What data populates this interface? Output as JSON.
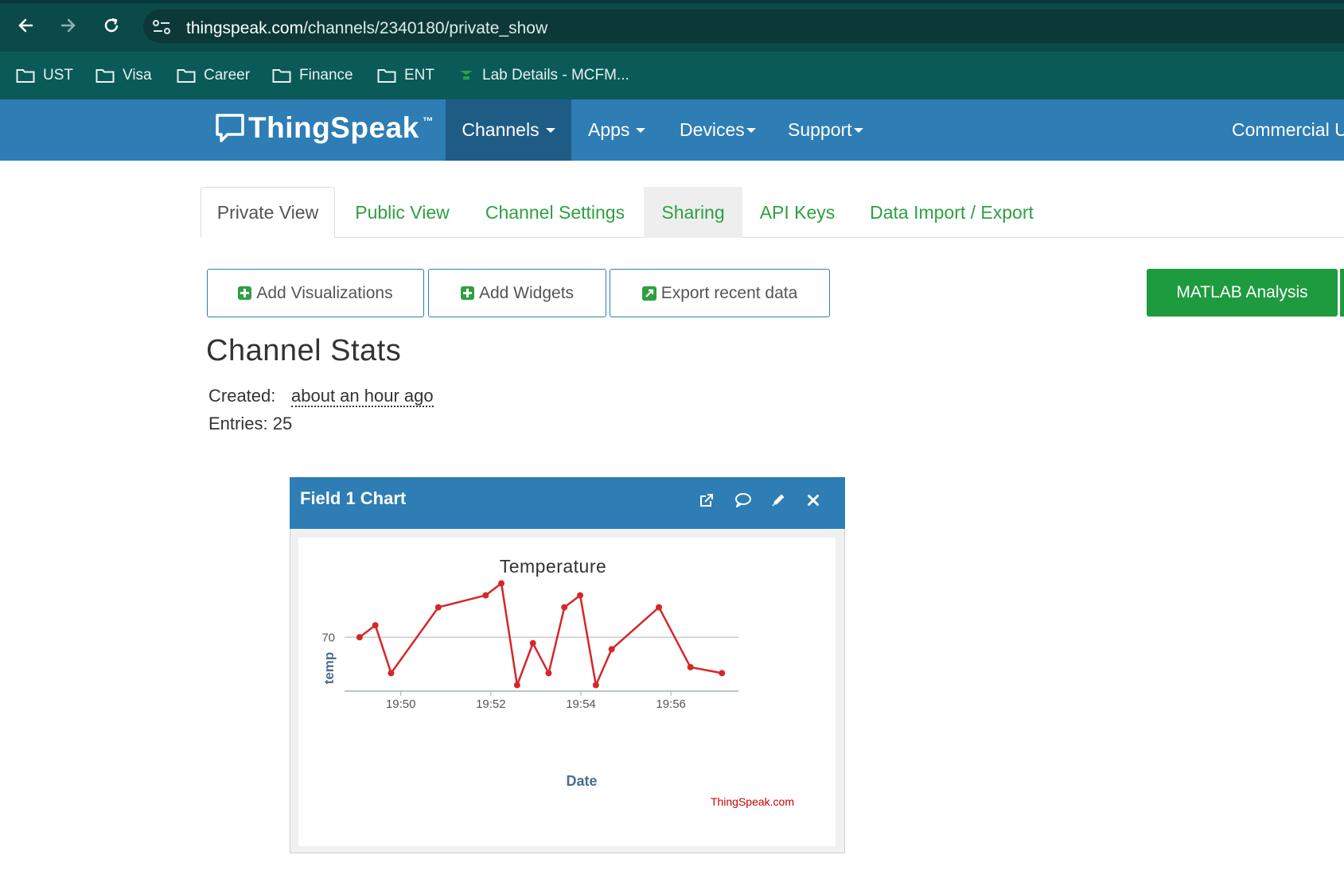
{
  "browser": {
    "url_host": "thingspeak.com",
    "url_path": "/channels/2340180/private_show",
    "bookmarks": [
      {
        "label": "UST",
        "icon": "folder-icon"
      },
      {
        "label": "Visa",
        "icon": "folder-icon"
      },
      {
        "label": "Career",
        "icon": "folder-icon"
      },
      {
        "label": "Finance",
        "icon": "folder-icon"
      },
      {
        "label": "ENT",
        "icon": "folder-icon"
      },
      {
        "label": "Lab Details - MCFM...",
        "icon": "site-favicon-icon"
      }
    ]
  },
  "site": {
    "logo": "ThingSpeak",
    "logo_tm": "™",
    "nav": {
      "channels": "Channels",
      "apps": "Apps",
      "devices": "Devices",
      "support": "Support",
      "commercial": "Commercial U"
    }
  },
  "tabs": [
    "Private View",
    "Public View",
    "Channel Settings",
    "Sharing",
    "API Keys",
    "Data Import / Export"
  ],
  "actions": {
    "add_visualizations": "Add Visualizations",
    "add_widgets": "Add Widgets",
    "export_recent": "Export recent data",
    "matlab_analysis": "MATLAB Analysis"
  },
  "stats": {
    "title": "Channel Stats",
    "created_label": "Created:",
    "created_value": "about an hour ago",
    "entries_label": "Entries:",
    "entries_value": "25"
  },
  "widget": {
    "title": "Field 1 Chart",
    "icons": [
      "external-link-icon",
      "comment-icon",
      "pencil-icon",
      "close-icon"
    ]
  },
  "colors": {
    "browser_bar": "#0a4a49",
    "navbar": "#2e7db5",
    "nav_active": "#1f5c85",
    "link_green": "#2ea043",
    "matlab_green": "#1e9a3f",
    "series": "#d62728",
    "credit": "#cc0000"
  },
  "chart_data": {
    "type": "line",
    "title": "Temperature",
    "xlabel": "Date",
    "ylabel": "temp",
    "x_ticks": [
      "19:50",
      "19:52",
      "19:54",
      "19:56"
    ],
    "y_ticks": [
      70
    ],
    "credit": "ThingSpeak.com",
    "series": [
      {
        "x": [
          "19:49:05",
          "19:49:26",
          "19:49:47",
          "19:50:50",
          "19:51:53",
          "19:52:14",
          "19:52:35",
          "19:52:56",
          "19:53:17",
          "19:53:38",
          "19:53:59",
          "19:54:20",
          "19:54:41",
          "19:55:44",
          "19:56:26",
          "19:57:08"
        ],
        "y": [
          70,
          71,
          67,
          72.5,
          73.5,
          74.5,
          66,
          69.5,
          67,
          72.5,
          73.5,
          66,
          69,
          72.5,
          67.5,
          67
        ]
      }
    ]
  }
}
